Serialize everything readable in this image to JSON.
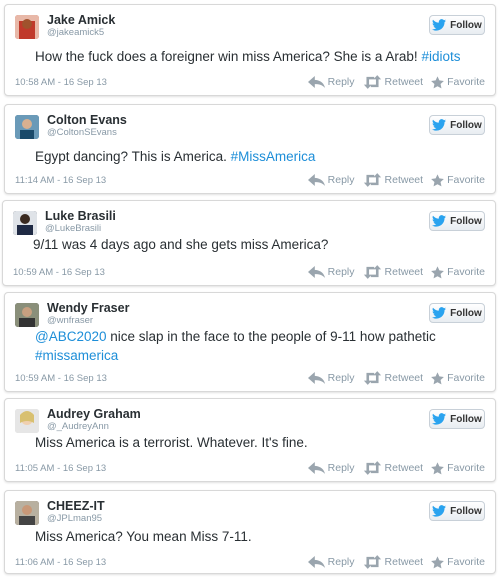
{
  "follow_label": "Follow",
  "actions": {
    "reply": "Reply",
    "retweet": "Retweet",
    "favorite": "Favorite"
  },
  "colors": {
    "link": "#1d8ed8",
    "twitter_bird": "#2aa3ef",
    "muted": "#8899a6"
  },
  "tweets": [
    {
      "name": "Jake Amick",
      "handle": "@jakeamick5",
      "text": "How the fuck does a foreigner win miss America? She is a Arab! ",
      "hashtag": "#idiots",
      "timestamp": "10:58 AM - 16 Sep 13"
    },
    {
      "name": "Colton Evans",
      "handle": "@ColtonSEvans",
      "text": "Egypt dancing? This is America. ",
      "hashtag": "#MissAmerica",
      "timestamp": "11:14 AM - 16 Sep 13"
    },
    {
      "name": "Luke Brasili",
      "handle": "@LukeBrasili",
      "text": "9/11 was 4 days ago and she gets miss America?",
      "hashtag": "",
      "timestamp": "10:59 AM - 16 Sep 13"
    },
    {
      "name": "Wendy Fraser",
      "handle": "@wnfraser",
      "mention": "@ABC2020",
      "text": " nice slap in the face to the people of 9-11 how pathetic",
      "hashtag": "#missamerica",
      "timestamp": "10:59 AM - 16 Sep 13"
    },
    {
      "name": "Audrey Graham",
      "handle": "@_AudreyAnn",
      "text": "Miss America is a terrorist. Whatever. It's fine.",
      "hashtag": "",
      "timestamp": "11:05 AM - 16 Sep 13"
    },
    {
      "name": "CHEEZ-IT",
      "handle": "@JPLman95",
      "text": "Miss America? You mean Miss 7-11.",
      "hashtag": "",
      "timestamp": "11:06 AM - 16 Sep 13"
    }
  ]
}
